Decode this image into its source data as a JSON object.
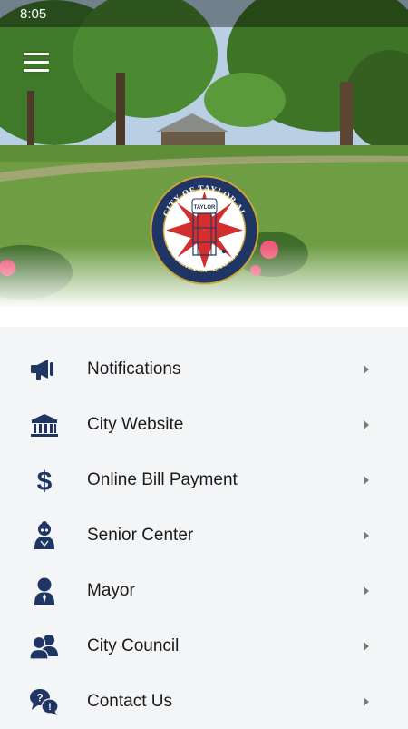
{
  "status_bar": {
    "time": "8:05"
  },
  "header": {
    "seal": {
      "top_text": "CITY OF TAYLOR AL",
      "bottom_text": "\"A GREAT PLACE TO LIVE\"",
      "tower_text": "TAYLOR"
    }
  },
  "menu": {
    "items": [
      {
        "label": "Notifications",
        "icon": "megaphone-icon"
      },
      {
        "label": "City Website",
        "icon": "building-icon"
      },
      {
        "label": "Online Bill Payment",
        "icon": "dollar-icon"
      },
      {
        "label": "Senior Center",
        "icon": "senior-person-icon"
      },
      {
        "label": "Mayor",
        "icon": "person-tie-icon"
      },
      {
        "label": "City Council",
        "icon": "group-icon"
      },
      {
        "label": "Contact Us",
        "icon": "question-chat-icon"
      }
    ]
  },
  "colors": {
    "icon": "#1f3563",
    "label": "#1b1b1b",
    "chevron": "#7a7a7a",
    "list_bg": "#f4f5f7"
  }
}
